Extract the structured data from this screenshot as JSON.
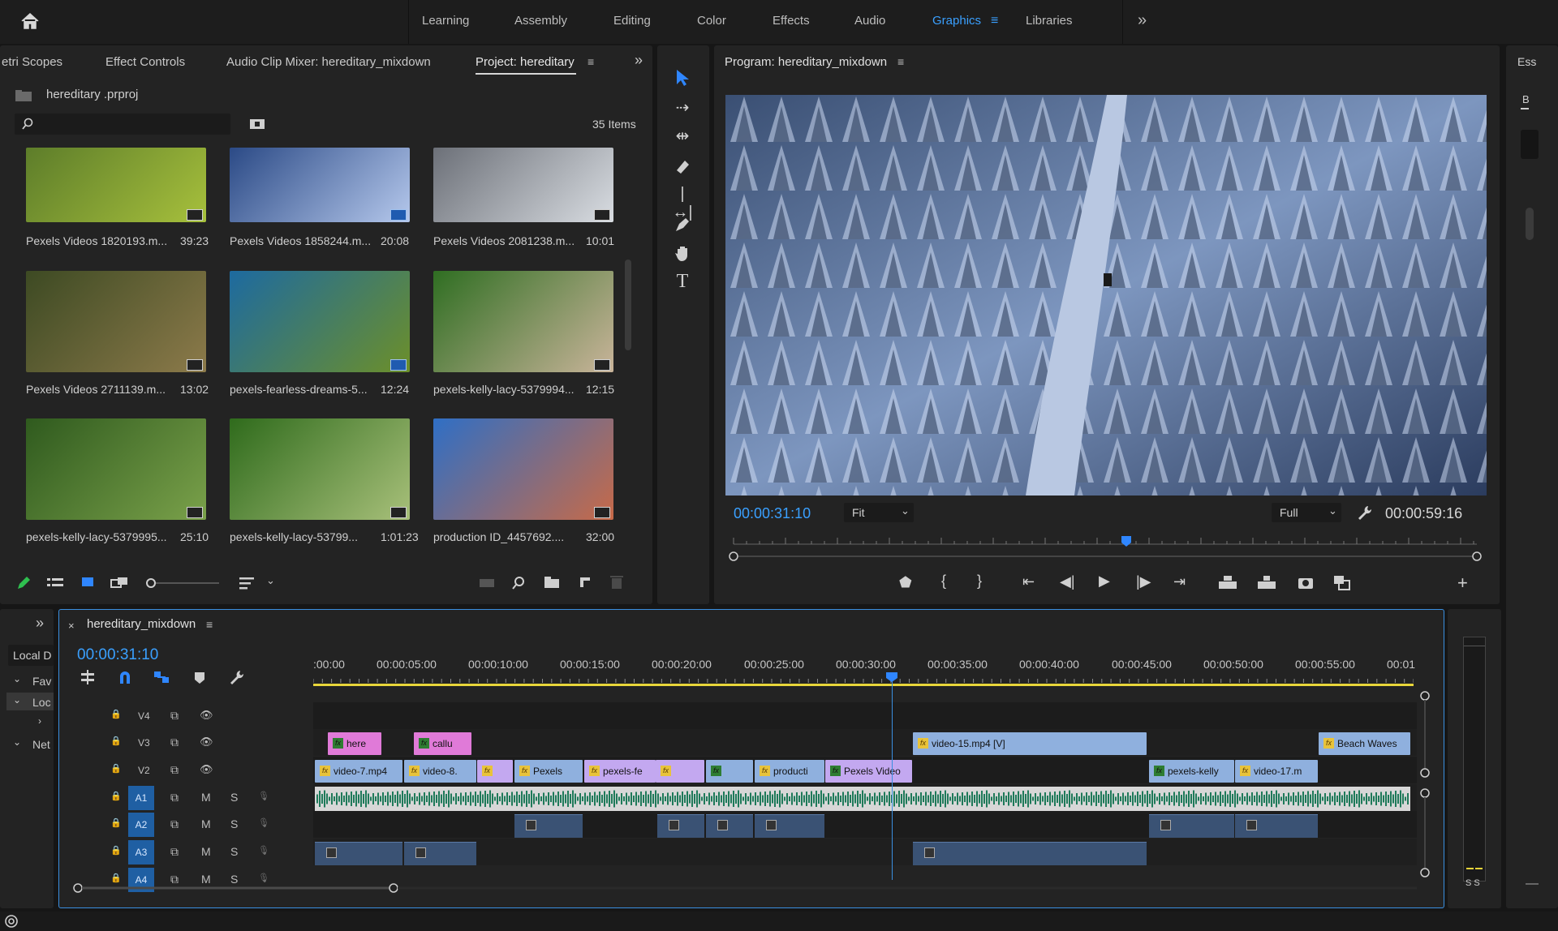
{
  "header": {
    "home_icon": "home-icon",
    "workspaces": [
      "Learning",
      "Assembly",
      "Editing",
      "Color",
      "Effects",
      "Audio",
      "Graphics",
      "Libraries"
    ],
    "active_workspace": "Graphics",
    "overflow": "»"
  },
  "left_panel": {
    "tabs": [
      "etri Scopes",
      "Effect Controls",
      "Audio Clip Mixer: hereditary_mixdown",
      "Project: hereditary"
    ],
    "active_tab": "Project: hereditary",
    "project_file": "hereditary .prproj",
    "search_placeholder": "",
    "items_count": "35 Items",
    "thumbnails": [
      {
        "name": "Pexels Videos 1820193.m...",
        "duration": "39:23",
        "colors": [
          "#5d7d2a",
          "#a7c03c"
        ]
      },
      {
        "name": "Pexels Videos 1858244.m...",
        "duration": "20:08",
        "colors": [
          "#2b4a86",
          "#b5c8ec"
        ]
      },
      {
        "name": "Pexels Videos 2081238.m...",
        "duration": "10:01",
        "colors": [
          "#6c7078",
          "#d9dde2"
        ]
      },
      {
        "name": "Pexels Videos 2711139.m...",
        "duration": "13:02",
        "colors": [
          "#3d4a23",
          "#8c7a4a"
        ]
      },
      {
        "name": "pexels-fearless-dreams-5...",
        "duration": "12:24",
        "colors": [
          "#1d6aa0",
          "#6c8f2a"
        ]
      },
      {
        "name": "pexels-kelly-lacy-5379994...",
        "duration": "12:15",
        "colors": [
          "#2f6e22",
          "#c9b49a"
        ]
      },
      {
        "name": "pexels-kelly-lacy-5379995...",
        "duration": "25:10",
        "colors": [
          "#2f5a1e",
          "#7aa14a"
        ]
      },
      {
        "name": "pexels-kelly-lacy-53799...",
        "duration": "1:01:23",
        "colors": [
          "#2f6b1c",
          "#a8c07a"
        ]
      },
      {
        "name": "production ID_4457692....",
        "duration": "32:00",
        "colors": [
          "#2f6fc5",
          "#c76a48"
        ]
      }
    ]
  },
  "program_monitor": {
    "title": "Program: hereditary_mixdown",
    "timecode_in": "00:00:31:10",
    "fit": "Fit",
    "quality": "Full",
    "timecode_out": "00:00:59:16"
  },
  "essentials": {
    "tab": "Ess",
    "letter": "B"
  },
  "timeline": {
    "sequence": "hereditary_mixdown",
    "timecode": "00:00:31:10",
    "ruler": [
      ":00:00",
      "00:00:05:00",
      "00:00:10:00",
      "00:00:15:00",
      "00:00:20:00",
      "00:00:25:00",
      "00:00:30:00",
      "00:00:35:00",
      "00:00:40:00",
      "00:00:45:00",
      "00:00:50:00",
      "00:00:55:00",
      "00:01"
    ],
    "tracks": [
      "V4",
      "V3",
      "V2",
      "A1",
      "A2",
      "A3",
      "A4"
    ],
    "track_m": "M",
    "track_s": "S",
    "left_items": [
      "Local D",
      "Fav",
      "Loc",
      "Net"
    ],
    "clips_v3": [
      "here",
      "callu",
      "video-15.mp4 [V]",
      "Beach Waves"
    ],
    "clips_v2": [
      "video-7.mp4",
      "video-8.",
      "",
      "Pexels",
      "pexels-fe",
      "",
      "",
      "producti",
      "Pexels Video",
      "pexels-kelly",
      "video-17.m"
    ],
    "meter_labels": "S S"
  }
}
